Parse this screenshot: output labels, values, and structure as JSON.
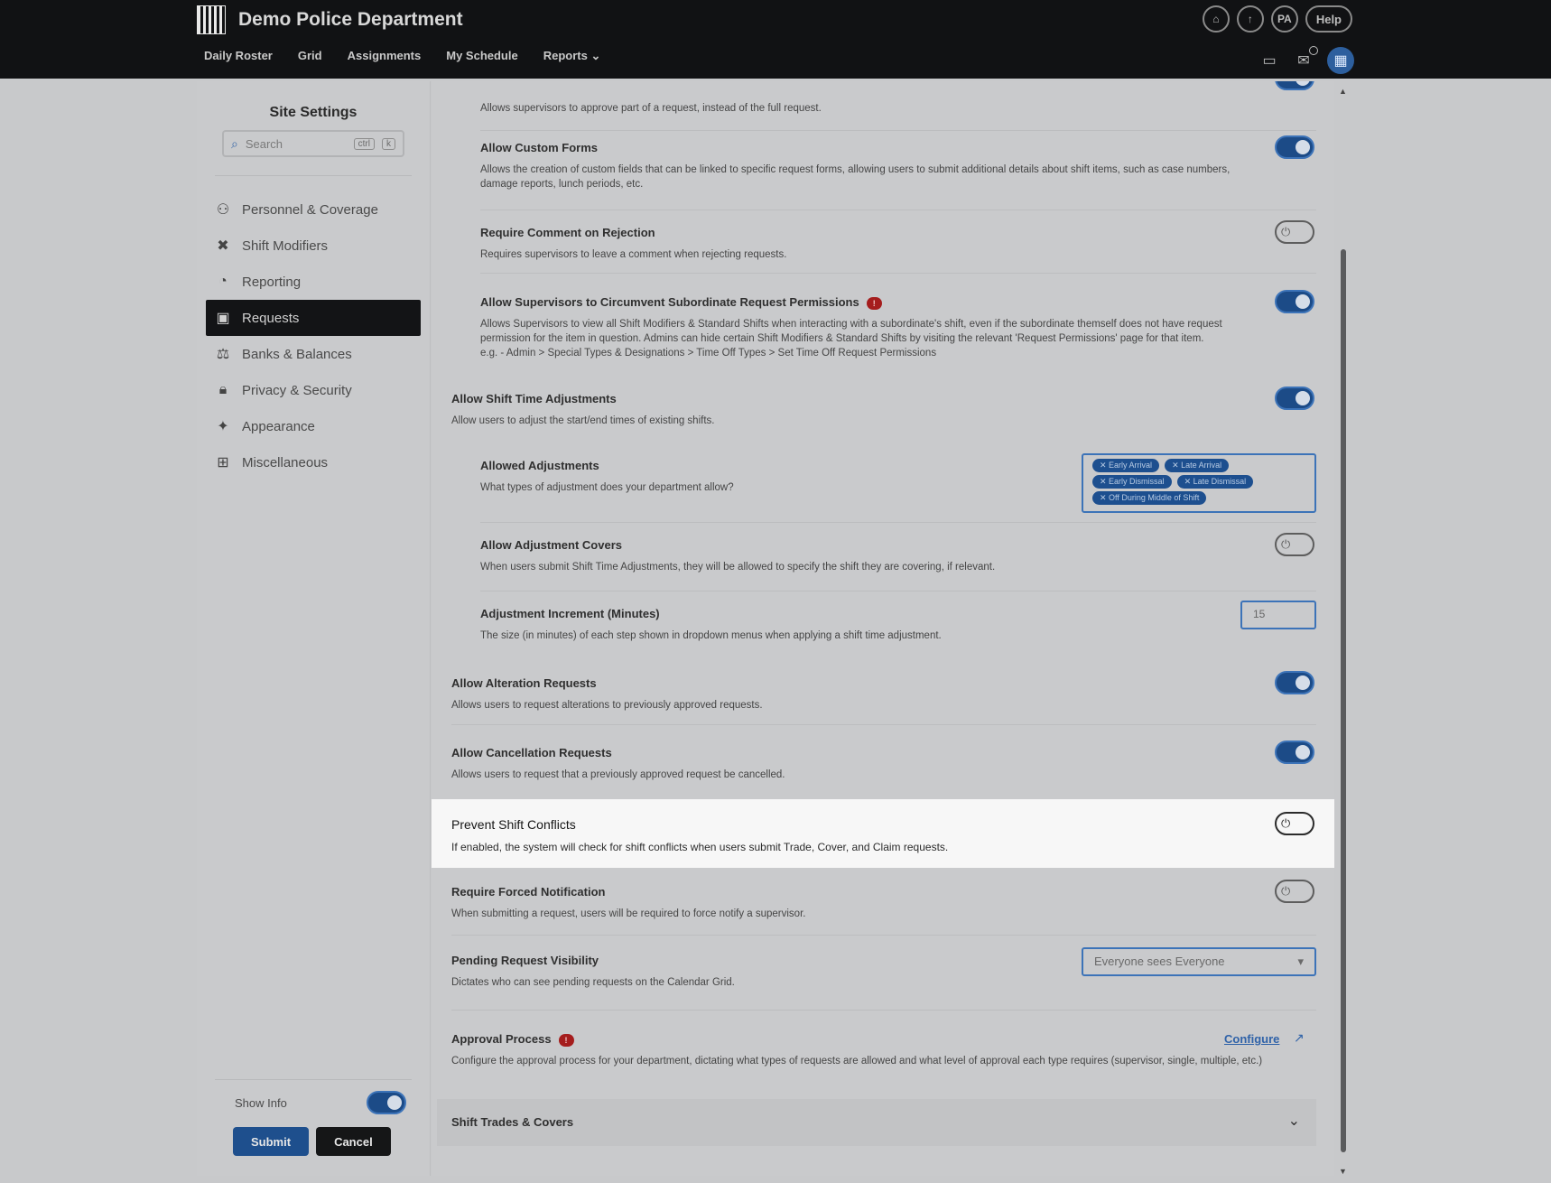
{
  "header": {
    "title": "Demo Police Department",
    "help_label": "Help",
    "avatar_initials": "PA",
    "nav": [
      "Daily Roster",
      "Grid",
      "Assignments",
      "My Schedule",
      "Reports"
    ]
  },
  "sidebar": {
    "title": "Site Settings",
    "search_placeholder": "Search",
    "kbd_ctrl": "ctrl",
    "kbd_k": "k",
    "items": [
      {
        "label": "Personnel & Coverage"
      },
      {
        "label": "Shift Modifiers"
      },
      {
        "label": "Reporting"
      },
      {
        "label": "Requests"
      },
      {
        "label": "Banks & Balances"
      },
      {
        "label": "Privacy & Security"
      },
      {
        "label": "Appearance"
      },
      {
        "label": "Miscellaneous"
      }
    ],
    "active_item": "Requests",
    "show_info_label": "Show Info",
    "show_info_enabled": true,
    "submit_label": "Submit",
    "cancel_label": "Cancel"
  },
  "settings": {
    "partial_desc": "Allows supervisors to approve part of a request, instead of the full request.",
    "custom_forms": {
      "title": "Allow Custom Forms",
      "desc": "Allows the creation of custom fields that can be linked to specific request forms, allowing users to submit additional details about shift items, such as case numbers, damage reports, lunch periods, etc.",
      "enabled": true
    },
    "comment_rejection": {
      "title": "Require Comment on Rejection",
      "desc": "Requires supervisors to leave a comment when rejecting requests.",
      "enabled": false
    },
    "circumvent": {
      "title": "Allow Supervisors to Circumvent Subordinate Request Permissions",
      "badge": "!",
      "desc": "Allows Supervisors to view all Shift Modifiers & Standard Shifts when interacting with a subordinate's shift, even if the subordinate themself does not have request permission for the item in question. Admins can hide certain Shift Modifiers & Standard Shifts by visiting the relevant 'Request Permissions' page for that item.",
      "desc2": "e.g. - Admin > Special Types & Designations > Time Off Types > Set Time Off Request Permissions",
      "enabled": true
    },
    "shift_time": {
      "title": "Allow Shift Time Adjustments",
      "desc": "Allow users to adjust the start/end times of existing shifts.",
      "enabled": true
    },
    "allowed_adjustments": {
      "title": "Allowed Adjustments",
      "desc": "What types of adjustment does your department allow?",
      "chips": [
        "✕ Early Arrival",
        "✕ Late Arrival",
        "✕ Early Dismissal",
        "✕ Late Dismissal",
        "✕ Off During Middle of Shift"
      ]
    },
    "adjustment_covers": {
      "title": "Allow Adjustment Covers",
      "desc": "When users submit Shift Time Adjustments, they will be allowed to specify the shift they are covering, if relevant.",
      "enabled": false
    },
    "increment": {
      "title": "Adjustment Increment (Minutes)",
      "desc": "The size (in minutes) of each step shown in dropdown menus when applying a shift time adjustment.",
      "value": "15"
    },
    "alteration": {
      "title": "Allow Alteration Requests",
      "desc": "Allows users to request alterations to previously approved requests.",
      "enabled": true
    },
    "cancellation": {
      "title": "Allow Cancellation Requests",
      "desc": "Allows users to request that a previously approved request be cancelled.",
      "enabled": true
    },
    "prevent_conflicts": {
      "title": "Prevent Shift Conflicts",
      "desc": "If enabled, the system will check for shift conflicts when users submit Trade, Cover, and Claim requests.",
      "enabled": false
    },
    "forced_notification": {
      "title": "Require Forced Notification",
      "desc": "When submitting a request, users will be required to force notify a supervisor.",
      "enabled": false
    },
    "pending_visibility": {
      "title": "Pending Request Visibility",
      "desc": "Dictates who can see pending requests on the Calendar Grid.",
      "value": "Everyone sees Everyone"
    },
    "approval": {
      "title": "Approval Process",
      "badge": "!",
      "desc": "Configure the approval process for your department, dictating what types of requests are allowed and what level of approval each type requires (supervisor, single, multiple, etc.)",
      "link": "Configure"
    },
    "section_trades": "Shift Trades & Covers"
  }
}
